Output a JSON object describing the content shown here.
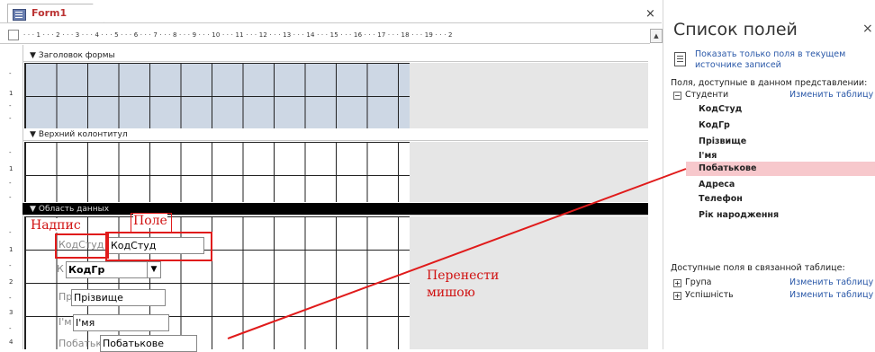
{
  "tab": {
    "label": "Form1",
    "close": "×"
  },
  "ruler": {
    "marks": "· · · 1 · · · 2 · · · 3 · · · 4 · · · 5 · · · 6 · · · 7 · · · 8 · · · 9 · · · 10 · · · 11 · · · 12 · · · 13 · · · 14 · · · 15 · · · 16 · · · 17 · · · 18 · · · 19 · · · 2",
    "scroll_up": "▲"
  },
  "vruler": {
    "a": [
      "-",
      "1",
      "-",
      "-"
    ],
    "b": [
      "-",
      "1",
      "-",
      "-"
    ],
    "c": [
      "-",
      "1",
      "-",
      "2",
      "-",
      "3",
      "-",
      "4"
    ]
  },
  "sections": {
    "header": "Заголовок формы",
    "page_header": "Верхний колонтитул",
    "detail": "Область данных"
  },
  "controls": {
    "kod_label": "КодСтуд",
    "kod_field": "КодСтуд",
    "kodgr_label": "К",
    "kodgr_field": "КодГр",
    "pr_label": "Пр",
    "pr_field": "Прізвище",
    "im_label": "І'м",
    "im_field": "І'мя",
    "pob_label": "Побатьк",
    "pob_field": "Побатькове"
  },
  "annotations": {
    "label": "Надпис",
    "field": "Поле",
    "drag": "Перенести\nмишою"
  },
  "panel": {
    "title": "Список полей",
    "close": "×",
    "show_only_link": "Показать только поля в текущем\nисточнике записей",
    "available_heading": "Поля, доступные в данном представлении:",
    "table_name": "Студенти",
    "edit_table": "Изменить таблицу",
    "fields": [
      "КодСтуд",
      "КодГр",
      "Прізвище",
      "І'мя",
      "Побатькове",
      "Адреса",
      "Телефон",
      "Рік народження"
    ],
    "related_heading": "Доступные поля в связанной таблице:",
    "related": [
      {
        "name": "Група",
        "edit": "Изменить таблицу"
      },
      {
        "name": "Успішність",
        "edit": "Изменить таблицу"
      }
    ]
  },
  "colors": {
    "accent_annotation": "#e01b1b",
    "highlight_row": "#f7c8cc",
    "section_bg": "#cdd7e4"
  }
}
